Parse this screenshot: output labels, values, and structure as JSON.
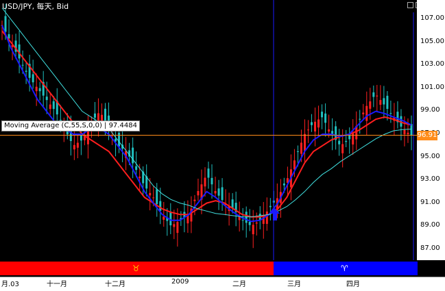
{
  "header": {
    "title": "USD/JPY, 每天, Bid"
  },
  "tooltip": {
    "text": "Moving Average (C,55,S,0,0) | 97.4484"
  },
  "price_label": "96.91",
  "colors": {
    "background": "#000000",
    "candle_up": "#ff2020",
    "candle_down": "#20c0c0",
    "ma_red": "#ff1e1e",
    "ma_blue": "#1a1aff",
    "ma_cyan": "#40e0e0",
    "vertical_line": "#1a1aff",
    "horizontal_line": "#ff8c1a",
    "bar_red": "#ff0000",
    "bar_blue": "#0000ff"
  },
  "chart_data": {
    "type": "candlestick",
    "title": "USD/JPY, 每天, Bid",
    "ylim": [
      86.5,
      107.5
    ],
    "y_ticks": [
      "107.00",
      "105.00",
      "103.00",
      "101.00",
      "99.00",
      "97.00",
      "95.00",
      "93.00",
      "91.00",
      "89.00",
      "87.00"
    ],
    "x_ticks": [
      "月.03",
      "十一月",
      "十二月",
      "2009",
      "二月",
      "三月",
      "四月"
    ],
    "current_price": 96.91,
    "close_series": [
      106.5,
      105.0,
      103.5,
      102.0,
      101.0,
      100.0,
      99.0,
      97.5,
      96.0,
      96.5,
      98.0,
      99.0,
      97.5,
      96.0,
      95.5,
      94.0,
      92.5,
      91.5,
      90.0,
      89.0,
      89.5,
      90.0,
      92.0,
      93.5,
      92.0,
      91.0,
      90.5,
      89.5,
      89.0,
      89.5,
      90.5,
      91.5,
      93.0,
      95.0,
      97.0,
      98.0,
      98.5,
      97.0,
      96.0,
      96.5,
      98.0,
      99.5,
      100.5,
      99.5,
      98.5,
      97.5,
      96.9
    ],
    "ma_series": [
      {
        "name": "MA red",
        "values": [
          106.0,
          105.0,
          104.0,
          103.0,
          102.0,
          101.0,
          100.0,
          99.0,
          98.0,
          97.0,
          96.5,
          96.0,
          95.5,
          94.5,
          93.5,
          92.5,
          91.5,
          91.0,
          90.5,
          90.2,
          90.0,
          90.0,
          90.5,
          91.0,
          91.2,
          91.0,
          90.5,
          90.0,
          89.8,
          89.8,
          90.0,
          90.5,
          91.5,
          93.0,
          94.5,
          95.5,
          96.0,
          96.5,
          96.8,
          97.0,
          97.3,
          97.8,
          98.3,
          98.5,
          98.3,
          98.0,
          97.8
        ]
      },
      {
        "name": "MA blue",
        "values": [
          106.5,
          104.5,
          103.0,
          101.5,
          100.0,
          99.0,
          98.0,
          97.5,
          97.0,
          97.0,
          97.5,
          97.5,
          97.0,
          96.0,
          95.0,
          93.5,
          92.0,
          91.0,
          90.0,
          89.5,
          89.5,
          90.0,
          91.0,
          92.0,
          91.5,
          90.8,
          90.2,
          89.7,
          89.4,
          89.5,
          90.0,
          91.0,
          92.5,
          94.0,
          95.5,
          96.5,
          97.0,
          97.0,
          96.8,
          97.0,
          97.8,
          98.6,
          99.0,
          98.8,
          98.5,
          98.2,
          97.8
        ]
      },
      {
        "name": "Moving Average (C,55,S,0,0)",
        "values": [
          108.0,
          107.0,
          106.0,
          105.0,
          104.0,
          103.0,
          102.0,
          101.0,
          100.0,
          99.0,
          98.5,
          98.0,
          97.5,
          96.5,
          95.5,
          94.5,
          93.5,
          92.5,
          91.8,
          91.3,
          91.0,
          90.8,
          90.5,
          90.3,
          90.1,
          90.0,
          89.9,
          89.8,
          89.8,
          89.9,
          90.0,
          90.3,
          90.7,
          91.3,
          92.0,
          92.8,
          93.5,
          94.0,
          94.6,
          95.1,
          95.6,
          96.1,
          96.6,
          97.0,
          97.3,
          97.4,
          97.45
        ]
      }
    ]
  }
}
